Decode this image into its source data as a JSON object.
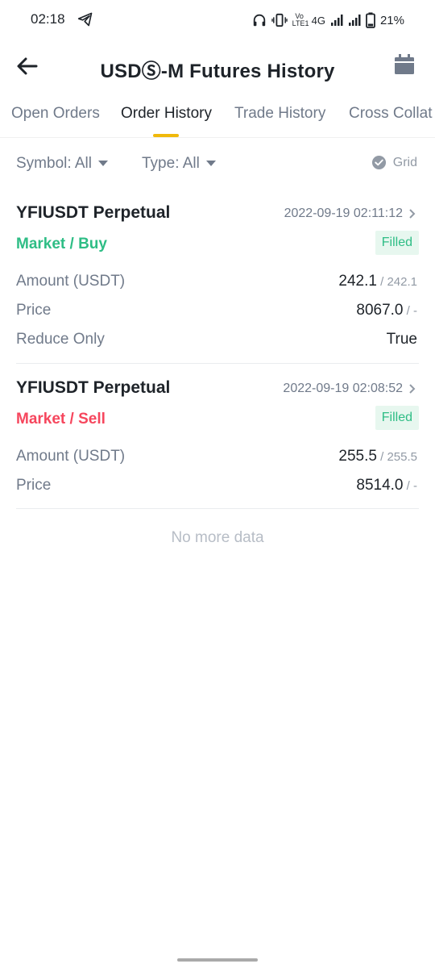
{
  "status_bar": {
    "time": "02:18",
    "battery": "21%",
    "network": "4G",
    "volte": "Vo LTE1"
  },
  "header": {
    "title": "USDⓈ-M Futures History"
  },
  "tabs": [
    {
      "label": "Open Orders",
      "active": false
    },
    {
      "label": "Order History",
      "active": true
    },
    {
      "label": "Trade History",
      "active": false
    },
    {
      "label": "Cross Collat",
      "active": false
    }
  ],
  "filters": {
    "symbol": "Symbol: All",
    "type": "Type: All",
    "grid": "Grid"
  },
  "orders": [
    {
      "symbol": "YFIUSDT Perpetual",
      "time": "2022-09-19 02:11:12",
      "side": "Market / Buy",
      "status": "Filled",
      "rows": [
        {
          "label": "Amount (USDT)",
          "value": "242.1",
          "sub": " / 242.1"
        },
        {
          "label": "Price",
          "value": "8067.0",
          "sub": " / -"
        },
        {
          "label": "Reduce Only",
          "value": "True",
          "sub": ""
        }
      ]
    },
    {
      "symbol": "YFIUSDT Perpetual",
      "time": "2022-09-19 02:08:52",
      "side": "Market / Sell",
      "status": "Filled",
      "rows": [
        {
          "label": "Amount (USDT)",
          "value": "255.5",
          "sub": " / 255.5"
        },
        {
          "label": "Price",
          "value": "8514.0",
          "sub": " / -"
        }
      ]
    }
  ],
  "footer": {
    "no_more": "No more data"
  },
  "colors": {
    "buy": "#2ebd85",
    "sell": "#f6465d",
    "accent": "#f0b90b",
    "badge_bg": "#e7f7ef"
  }
}
